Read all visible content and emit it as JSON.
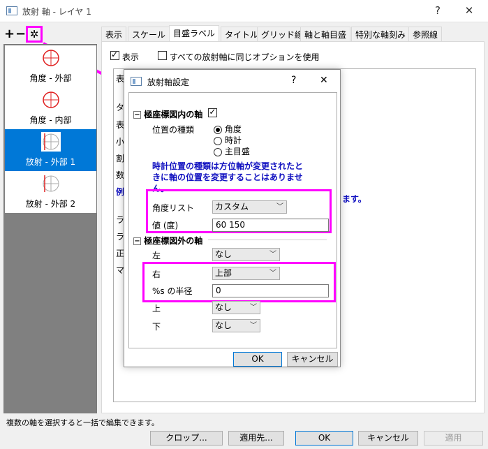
{
  "window": {
    "title": "放射 軸 - レイヤ 1",
    "help": "?",
    "close": "✕"
  },
  "toolbar": {
    "add": "+",
    "remove": "−",
    "settings": "✲"
  },
  "axis_list": [
    {
      "label": "角度 - 外部"
    },
    {
      "label": "角度 - 内部"
    },
    {
      "label": "放射 - 外部 1"
    },
    {
      "label": "放射 - 外部 2"
    }
  ],
  "tabs": [
    "表示",
    "スケール",
    "目盛ラベル",
    "タイトル",
    "グリッド線",
    "軸と軸目盛",
    "特別な軸刻み",
    "参照線"
  ],
  "panel": {
    "show_label": "表示",
    "same_options_label": "すべての放射軸に同じオプションを使用",
    "partial_left_letters": [
      "表",
      "タ",
      "表",
      "小",
      "割",
      "数",
      "例",
      "ラ",
      "ラ",
      "正",
      "マ"
    ],
    "partial_right_text": "ます。"
  },
  "status_text": "複数の軸を選択すると一括で編集できます。",
  "buttons": {
    "crop": "クロップ...",
    "apply_to": "適用先...",
    "ok": "OK",
    "cancel": "キャンセル",
    "apply": "適用"
  },
  "dialog": {
    "title": "放射軸設定",
    "help": "?",
    "close": "✕",
    "inner_section": {
      "title": "極座標図内の軸",
      "toggle": "⊟",
      "position_type_label": "位置の種類",
      "options": [
        "角度",
        "時計",
        "主目盛"
      ],
      "selected": "角度",
      "note_line1": "時計位置の種類は方位軸が変更されたと",
      "note_line2": "きに軸の位置を変更することはありませ",
      "note_line3": "ん。",
      "angle_list_label": "角度リスト",
      "angle_list_value": "カスタム",
      "value_label": "値 (度)",
      "value": "60 150"
    },
    "outer_section": {
      "title": "極座標図外の軸",
      "toggle": "⊟",
      "left_label": "左",
      "left_value": "なし",
      "right_label": "右",
      "right_value": "上部",
      "radius_label": "%s の半径",
      "radius_value": "0",
      "top_label": "上",
      "top_value": "なし",
      "bottom_label": "下",
      "bottom_value": "なし"
    },
    "ok": "OK",
    "cancel": "キャンセル"
  },
  "colors": {
    "highlight": "#ff00ff",
    "selection": "#0078d7",
    "note": "#1010c0"
  }
}
